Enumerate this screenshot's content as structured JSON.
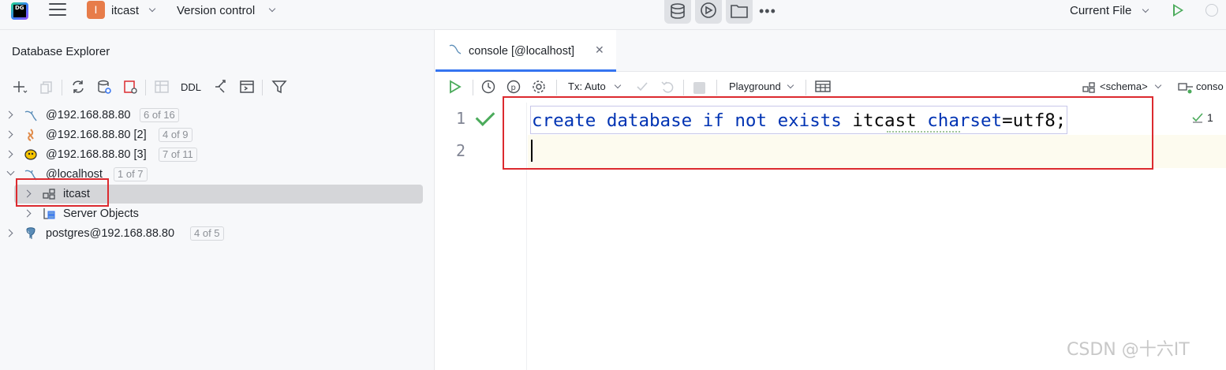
{
  "titlebar": {
    "logo_text": "DG",
    "project_badge": "I",
    "project_name": "itcast",
    "version_control": "Version control",
    "run_config": "Current File",
    "more": "•••"
  },
  "database_explorer": {
    "title": "Database Explorer",
    "toolbar": {
      "ddl_label": "DDL"
    },
    "tree": [
      {
        "label": "@192.168.88.80",
        "count": "6 of 16",
        "icon": "mysql-icon"
      },
      {
        "label": "@192.168.88.80 [2]",
        "count": "4 of 9",
        "icon": "oracle-icon"
      },
      {
        "label": "@192.168.88.80 [3]",
        "count": "7 of 11",
        "icon": "hive-icon"
      },
      {
        "label": "@localhost",
        "count": "1 of 7",
        "icon": "mysql-icon",
        "expanded": true
      },
      {
        "label": "itcast",
        "icon": "schema-icon",
        "selected": true
      },
      {
        "label": "Server Objects",
        "icon": "server-objects-icon"
      },
      {
        "label": "postgres@192.168.88.80",
        "count": "4 of 5",
        "icon": "postgres-icon"
      }
    ]
  },
  "editor": {
    "tab_label": "console [@localhost]",
    "toolbar": {
      "tx_mode": "Tx: Auto",
      "mode": "Playground",
      "schema": "<schema>",
      "console": "conso"
    },
    "line_numbers": [
      "1",
      "2"
    ],
    "code_line1": {
      "t1": "create",
      "t2": " ",
      "t3": "database",
      "t4": " ",
      "t5": "if",
      "t6": " ",
      "t7": "not",
      "t8": " ",
      "t9": "exists",
      "t10": " itcast ",
      "t11": "charset",
      "t12": "=utf8;"
    },
    "inspection_count": "1"
  },
  "watermark": "CSDN @十六IT",
  "colors": {
    "accent": "#3574f0",
    "run_green": "#4bab5b",
    "highlight_red": "#dc2a2f",
    "keyword": "#0033b3"
  }
}
